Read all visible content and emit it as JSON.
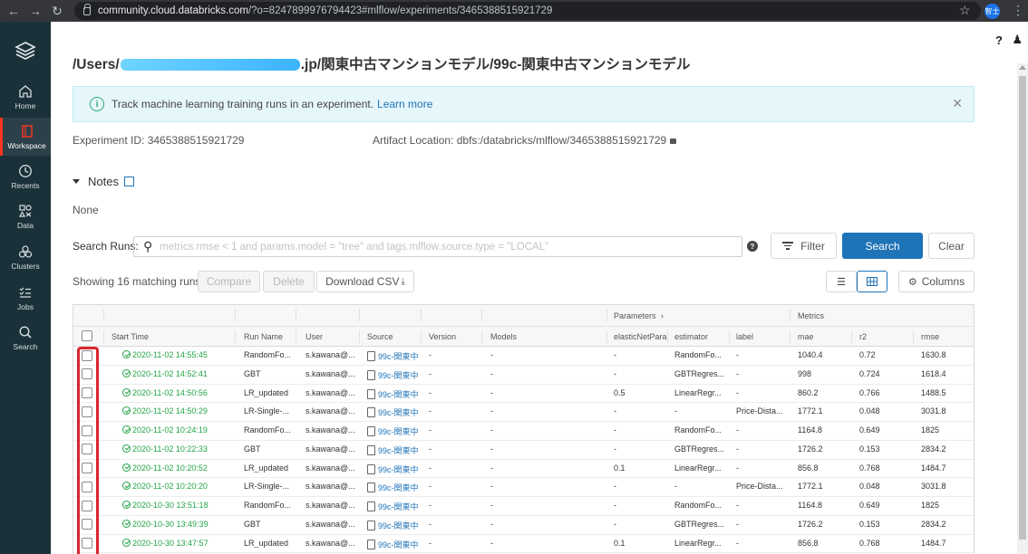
{
  "browser": {
    "url_host": "community.cloud.databricks.com",
    "url_rest": "/?o=8247899976794423#mlflow/experiments/3465388515921729",
    "profile_label": "智士"
  },
  "sidebar": {
    "items": [
      {
        "label": "Home",
        "icon": "home-icon"
      },
      {
        "label": "Workspace",
        "icon": "workspace-icon"
      },
      {
        "label": "Recents",
        "icon": "clock-icon"
      },
      {
        "label": "Data",
        "icon": "data-icon"
      },
      {
        "label": "Clusters",
        "icon": "clusters-icon"
      },
      {
        "label": "Jobs",
        "icon": "jobs-icon"
      },
      {
        "label": "Search",
        "icon": "search-icon"
      }
    ]
  },
  "page": {
    "title_prefix": "/Users/",
    "title_suffix": ".jp/関東中古マンションモデル/99c-関東中古マンションモデル",
    "banner_text": "Track machine learning training runs in an experiment.",
    "banner_link": "Learn more",
    "experiment_id_label": "Experiment ID:",
    "experiment_id": "3465388515921729",
    "artifact_label": "Artifact Location:",
    "artifact_value": "dbfs:/databricks/mlflow/3465388515921729",
    "notes_label": "Notes",
    "notes_value": "None",
    "search_label": "Search Runs:",
    "search_placeholder": "metrics.rmse < 1 and params.model = \"tree\" and tags.mlflow.source.type = \"LOCAL\"",
    "filter_label": "Filter",
    "search_button": "Search",
    "clear_button": "Clear",
    "showing_text": "Showing 16 matching runs",
    "compare_button": "Compare",
    "delete_button": "Delete",
    "download_button": "Download CSV",
    "columns_button": "Columns"
  },
  "table": {
    "group_headers": {
      "parameters": "Parameters",
      "metrics": "Metrics"
    },
    "columns": [
      "Start Time",
      "Run Name",
      "User",
      "Source",
      "Version",
      "Models",
      "elasticNetParam",
      "estimator",
      "label",
      "mae",
      "r2",
      "rmse"
    ],
    "rows": [
      {
        "time": "2020-11-02 14:55:45",
        "name": "RandomFo...",
        "user": "s.kawana@...",
        "source": "99c-関東中",
        "version": "-",
        "models": "-",
        "enp": "-",
        "estimator": "RandomFo...",
        "label": "-",
        "mae": "1040.4",
        "r2": "0.72",
        "rmse": "1630.8"
      },
      {
        "time": "2020-11-02 14:52:41",
        "name": "GBT",
        "user": "s.kawana@...",
        "source": "99c-関東中",
        "version": "-",
        "models": "-",
        "enp": "-",
        "estimator": "GBTRegres...",
        "label": "-",
        "mae": "998",
        "r2": "0.724",
        "rmse": "1618.4"
      },
      {
        "time": "2020-11-02 14:50:56",
        "name": "LR_updated",
        "user": "s.kawana@...",
        "source": "99c-関東中",
        "version": "-",
        "models": "-",
        "enp": "0.5",
        "estimator": "LinearRegr...",
        "label": "-",
        "mae": "860.2",
        "r2": "0.766",
        "rmse": "1488.5"
      },
      {
        "time": "2020-11-02 14:50:29",
        "name": "LR-Single-...",
        "user": "s.kawana@...",
        "source": "99c-関東中",
        "version": "-",
        "models": "-",
        "enp": "-",
        "estimator": "-",
        "label": "Price-Dista...",
        "mae": "1772.1",
        "r2": "0.048",
        "rmse": "3031.8"
      },
      {
        "time": "2020-11-02 10:24:19",
        "name": "RandomFo...",
        "user": "s.kawana@...",
        "source": "99c-関東中",
        "version": "-",
        "models": "-",
        "enp": "-",
        "estimator": "RandomFo...",
        "label": "-",
        "mae": "1164.8",
        "r2": "0.649",
        "rmse": "1825"
      },
      {
        "time": "2020-11-02 10:22:33",
        "name": "GBT",
        "user": "s.kawana@...",
        "source": "99c-関東中",
        "version": "-",
        "models": "-",
        "enp": "-",
        "estimator": "GBTRegres...",
        "label": "-",
        "mae": "1726.2",
        "r2": "0.153",
        "rmse": "2834.2"
      },
      {
        "time": "2020-11-02 10:20:52",
        "name": "LR_updated",
        "user": "s.kawana@...",
        "source": "99c-関東中",
        "version": "-",
        "models": "-",
        "enp": "0.1",
        "estimator": "LinearRegr...",
        "label": "-",
        "mae": "856.8",
        "r2": "0.768",
        "rmse": "1484.7"
      },
      {
        "time": "2020-11-02 10:20:20",
        "name": "LR-Single-...",
        "user": "s.kawana@...",
        "source": "99c-関東中",
        "version": "-",
        "models": "-",
        "enp": "-",
        "estimator": "-",
        "label": "Price-Dista...",
        "mae": "1772.1",
        "r2": "0.048",
        "rmse": "3031.8"
      },
      {
        "time": "2020-10-30 13:51:18",
        "name": "RandomFo...",
        "user": "s.kawana@...",
        "source": "99c-関東中",
        "version": "-",
        "models": "-",
        "enp": "-",
        "estimator": "RandomFo...",
        "label": "-",
        "mae": "1164.8",
        "r2": "0.649",
        "rmse": "1825"
      },
      {
        "time": "2020-10-30 13:49:39",
        "name": "GBT",
        "user": "s.kawana@...",
        "source": "99c-関東中",
        "version": "-",
        "models": "-",
        "enp": "-",
        "estimator": "GBTRegres...",
        "label": "-",
        "mae": "1726.2",
        "r2": "0.153",
        "rmse": "2834.2"
      },
      {
        "time": "2020-10-30 13:47:57",
        "name": "LR_updated",
        "user": "s.kawana@...",
        "source": "99c-関東中",
        "version": "-",
        "models": "-",
        "enp": "0.1",
        "estimator": "LinearRegr...",
        "label": "-",
        "mae": "856.8",
        "r2": "0.768",
        "rmse": "1484.7"
      }
    ]
  }
}
